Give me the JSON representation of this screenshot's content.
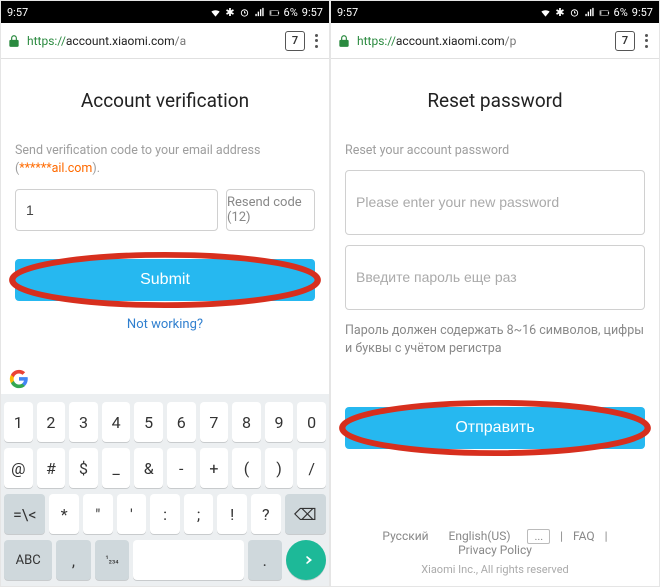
{
  "statusbar": {
    "time": "9:57",
    "battery": "6%"
  },
  "browser": {
    "tab_count": "7"
  },
  "left": {
    "url_https": "https://",
    "url_host": "account.xiaomi.com",
    "url_path": "/a",
    "title": "Account verification",
    "hint_prefix": "Send verification code to your email address (",
    "hint_masked": "******ail.com",
    "hint_suffix": ").",
    "code_value": "1",
    "resend_label": "Resend code (12)",
    "submit_label": "Submit",
    "not_working": "Not working?"
  },
  "right": {
    "url_https": "https://",
    "url_host": "account.xiaomi.com",
    "url_path": "/p",
    "title": "Reset password",
    "subtitle": "Reset your account password",
    "pw1_placeholder": "Please enter your new password",
    "pw2_placeholder": "Введите пароль еще раз",
    "hint": "Пароль должен содержать 8~16 символов, цифры и буквы с учётом регистра",
    "submit_label": "Отправить",
    "lang_ru": "Русский",
    "lang_en": "English(US)",
    "lang_more": "...",
    "faq": "FAQ",
    "privacy": "Privacy Policy",
    "copyright": "Xiaomi Inc., All rights reserved"
  },
  "keyboard": {
    "row1": [
      "1",
      "2",
      "3",
      "4",
      "5",
      "6",
      "7",
      "8",
      "9",
      "0"
    ],
    "row2": [
      "@",
      "#",
      "$",
      "_",
      "&",
      "-",
      "+",
      "(",
      ")",
      "/"
    ],
    "row3_shift": "=\\<",
    "row3": [
      "*",
      "\"",
      "'",
      ":",
      ";",
      "!",
      "?"
    ],
    "row3_del": "⌫",
    "row4_abc": "ABC",
    "row4_comma": ",",
    "row4_lang": "¹₂₃₄",
    "row4_dot": "."
  }
}
